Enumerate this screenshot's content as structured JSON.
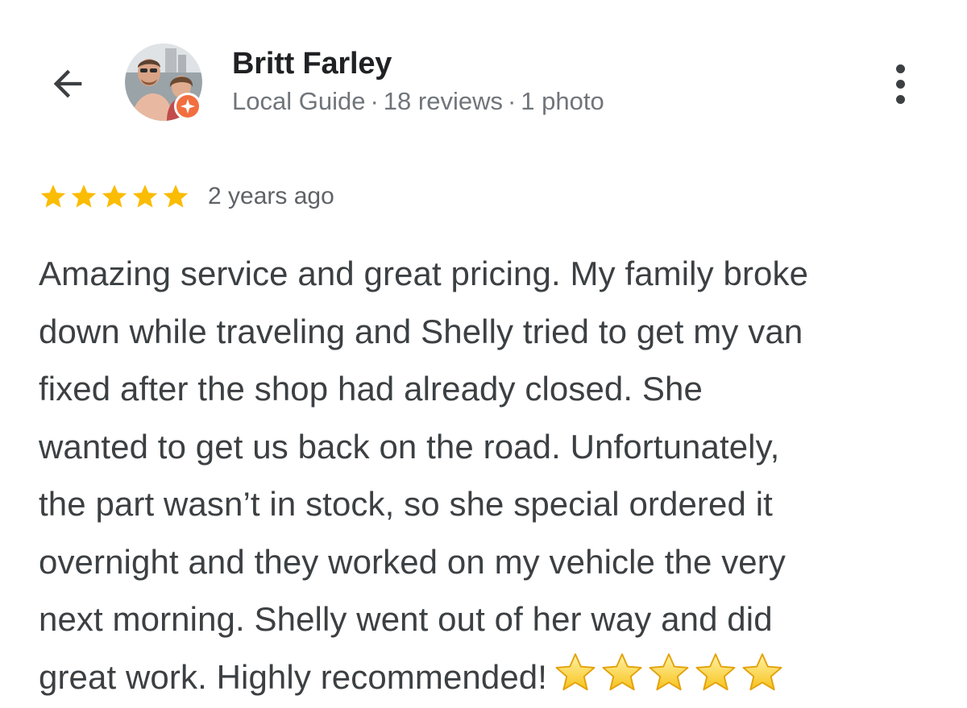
{
  "header": {
    "back_icon": "arrow-left-icon",
    "author": {
      "name": "Britt Farley",
      "badge": "Local Guide",
      "reviews": "18 reviews",
      "photos": "1 photo",
      "separator": "·",
      "avatar_icon": "profile-photo",
      "badge_icon": "local-guide-badge-icon"
    },
    "more_icon": "more-vert-icon"
  },
  "review": {
    "rating": 5,
    "rating_max": 5,
    "star_color": "#fbbc04",
    "date": "2 years ago",
    "text_lines": [
      "Amazing service and great pricing. My family broke",
      "down while traveling and Shelly tried to get my van",
      "fixed after the shop had already closed. She",
      "wanted to get us back on the road. Unfortunately,",
      "the part wasn’t in stock, so she special ordered it",
      "overnight and they worked on my vehicle the very",
      "next morning. Shelly went out of her way and did",
      "great work. Highly recommended!"
    ],
    "trailing_emoji": "⭐⭐⭐⭐⭐",
    "emoji_star_count": 5
  }
}
